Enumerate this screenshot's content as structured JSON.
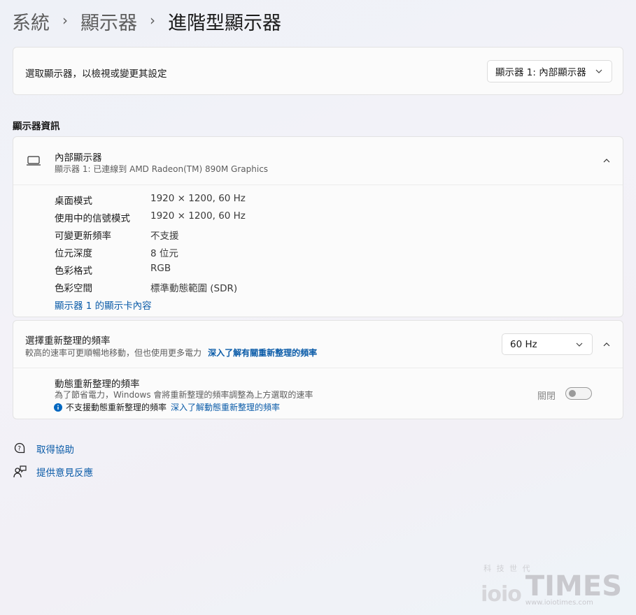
{
  "breadcrumb": {
    "items": [
      "系統",
      "顯示器",
      "進階型顯示器"
    ],
    "separator": "›"
  },
  "select_display": {
    "label": "選取顯示器，以檢視或變更其設定",
    "dropdown_value": "顯示器 1: 內部顯示器"
  },
  "display_info": {
    "section_title": "顯示器資訊",
    "header_title": "內部顯示器",
    "header_subtitle": "顯示器 1: 已連線到 AMD Radeon(TM) 890M Graphics",
    "rows": [
      {
        "label": "桌面模式",
        "value": "1920 × 1200, 60 Hz"
      },
      {
        "label": "使用中的信號模式",
        "value": "1920 × 1200, 60 Hz"
      },
      {
        "label": "可變更新頻率",
        "value": "不支援"
      },
      {
        "label": "位元深度",
        "value": "8 位元"
      },
      {
        "label": "色彩格式",
        "value": "RGB"
      },
      {
        "label": "色彩空間",
        "value": "標準動態範圍 (SDR)"
      }
    ],
    "adapter_link": "顯示器 1 的顯示卡內容"
  },
  "refresh_rate": {
    "title": "選擇重新整理的頻率",
    "subtitle": "較高的速率可更順暢地移動，但也使用更多電力",
    "learn_link": "深入了解有關重新整理的頻率",
    "dropdown_value": "60 Hz",
    "dynamic": {
      "title": "動態重新整理的頻率",
      "subtitle": "為了節省電力，Windows 會將重新整理的頻率調整為上方選取的速率",
      "info_text": "不支援動態重新整理的頻率",
      "info_link": "深入了解動態重新整理的頻率",
      "toggle_label": "關閉"
    }
  },
  "footer": {
    "help": "取得協助",
    "feedback": "提供意見反應"
  },
  "watermark": {
    "tagline": "科 技 世 代",
    "brand": "TIMES",
    "url": "www.ioiotimes.com"
  },
  "colors": {
    "accent_link": "#0a5ba8",
    "info_blue": "#0067c0"
  }
}
